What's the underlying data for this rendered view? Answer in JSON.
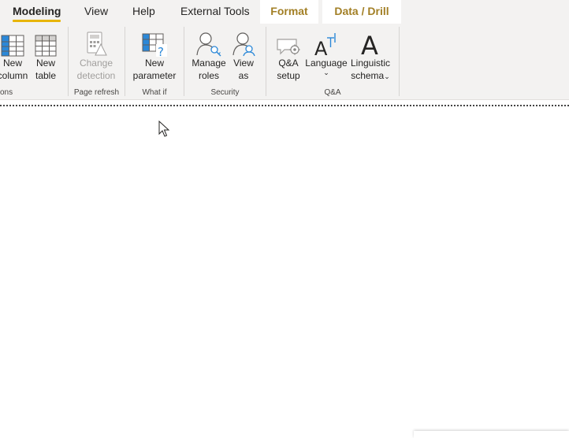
{
  "tabs": [
    {
      "label": "Modeling",
      "active": true
    },
    {
      "label": "View"
    },
    {
      "label": "Help"
    },
    {
      "label": "External Tools"
    },
    {
      "label": "Format",
      "contextual": true
    },
    {
      "label": "Data / Drill",
      "contextual": true
    }
  ],
  "colors": {
    "accent_underline": "#e8b509",
    "contextual_tab_text": "#a27f25",
    "ribbon_bg": "#f3f2f1",
    "icon_blue": "#2b88d8"
  },
  "groups": {
    "calculations": {
      "label": "ons",
      "buttons": [
        {
          "line1": "New",
          "line2": "column",
          "icon": "new-column-icon"
        },
        {
          "line1": "New",
          "line2": "table",
          "icon": "new-table-icon"
        }
      ]
    },
    "page_refresh": {
      "label": "Page refresh",
      "buttons": [
        {
          "line1": "Change",
          "line2": "detection",
          "icon": "change-detection-icon",
          "disabled": true
        }
      ]
    },
    "what_if": {
      "label": "What if",
      "buttons": [
        {
          "line1": "New",
          "line2": "parameter",
          "icon": "new-parameter-icon"
        }
      ]
    },
    "security": {
      "label": "Security",
      "buttons": [
        {
          "line1": "Manage",
          "line2": "roles",
          "icon": "manage-roles-icon"
        },
        {
          "line1": "View",
          "line2": "as",
          "icon": "view-as-icon"
        }
      ]
    },
    "qna": {
      "label": "Q&A",
      "buttons": [
        {
          "line1": "Q&A",
          "line2": "setup",
          "icon": "qna-setup-icon"
        },
        {
          "line1": "Language",
          "line2": "",
          "icon": "language-icon",
          "dropdown": true
        },
        {
          "line1": "Linguistic",
          "line2": "schema",
          "icon": "linguistic-schema-icon",
          "dropdown": true
        }
      ]
    }
  }
}
